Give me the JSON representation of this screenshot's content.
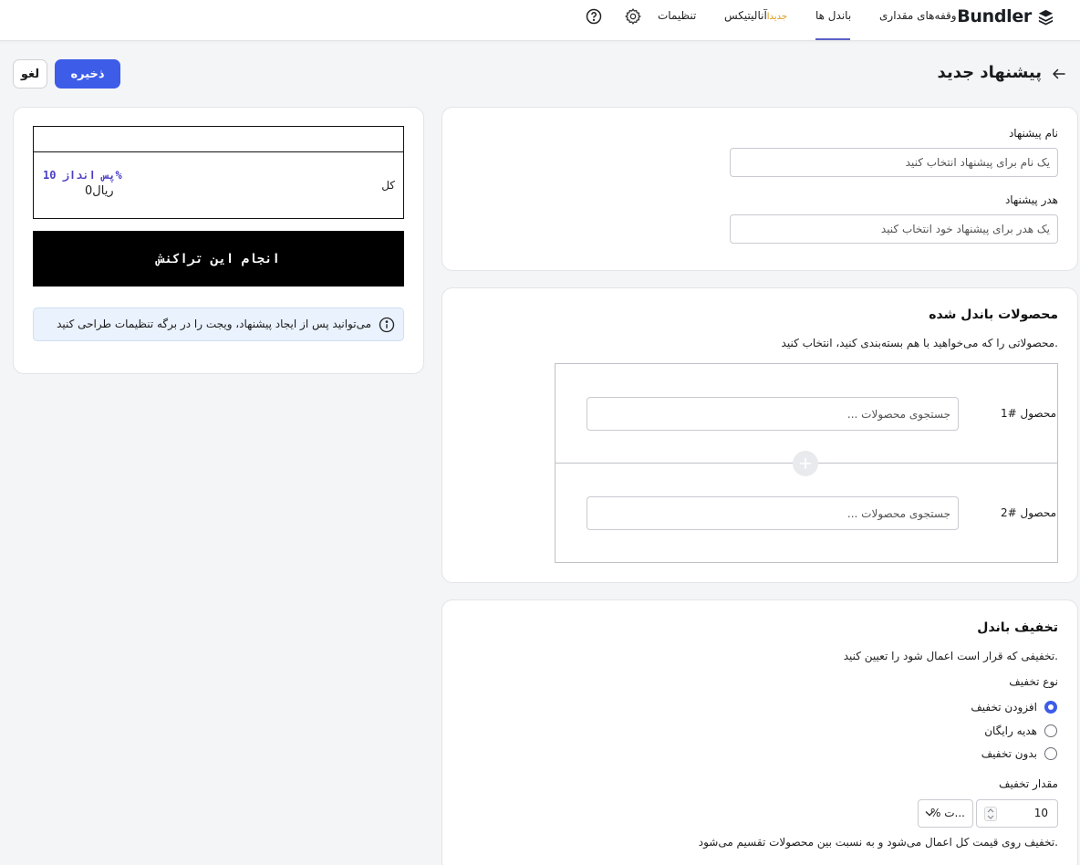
{
  "brand": {
    "name": "Bundler"
  },
  "nav": {
    "items": [
      {
        "label": "وقفه‌های مقداری"
      },
      {
        "label": "باندل ها"
      },
      {
        "label": "آنالیتیکس"
      },
      {
        "label": "تنظیمات"
      }
    ],
    "new_badge": "جدیدا",
    "active_index": 1
  },
  "header": {
    "title": "پیشنهاد جدید",
    "save_label": "ذخیره",
    "cancel_label": "لغو"
  },
  "offer_info": {
    "name_label": "نام پیشنهاد",
    "name_placeholder": "یک نام برای پیشنهاد انتخاب کنید",
    "header_label": "هدر پیشنهاد",
    "header_placeholder": "یک هدر برای پیشنهاد خود انتخاب کنید"
  },
  "bundled_products": {
    "title": "محصولات باندل شده",
    "subtitle": "محصولاتی را که می‌خواهید با هم بسته‌بندی کنید، انتخاب کنید.",
    "products": [
      {
        "label": "محصول #1",
        "placeholder": "جستجوی محصولات ..."
      },
      {
        "label": "محصول #2",
        "placeholder": "جستجوی محصولات ..."
      }
    ]
  },
  "discount": {
    "title": "تخفیف باندل",
    "subtitle": "تخفیفی که قرار است اعمال شود را تعیین کنید.",
    "type_label": "نوع تخفیف",
    "options": [
      {
        "label": "افزودن تخفیف",
        "checked": true
      },
      {
        "label": "هدیه رایگان",
        "checked": false
      },
      {
        "label": "بدون تخفیف",
        "checked": false
      }
    ],
    "amount_label": "مقدار تخفیف",
    "amount_value": "10",
    "unit_value": "% ت...",
    "note": "تخفیف روی قیمت کل اعمال می‌شود و به نسبت بین محصولات تقسیم می‌شود."
  },
  "preview": {
    "total_label": "کل",
    "savings_label": "پس انداز 10%",
    "price": "ریال0",
    "cta_label": "انجام این تراکنش",
    "info_text": "می‌توانید پس از ایجاد پیشنهاد، ویجت را در برگه تنظیمات طراحی کنید"
  },
  "colors": {
    "accent": "#3d5ce8",
    "savings": "#4a3ec4",
    "badge": "#d99a1c"
  }
}
